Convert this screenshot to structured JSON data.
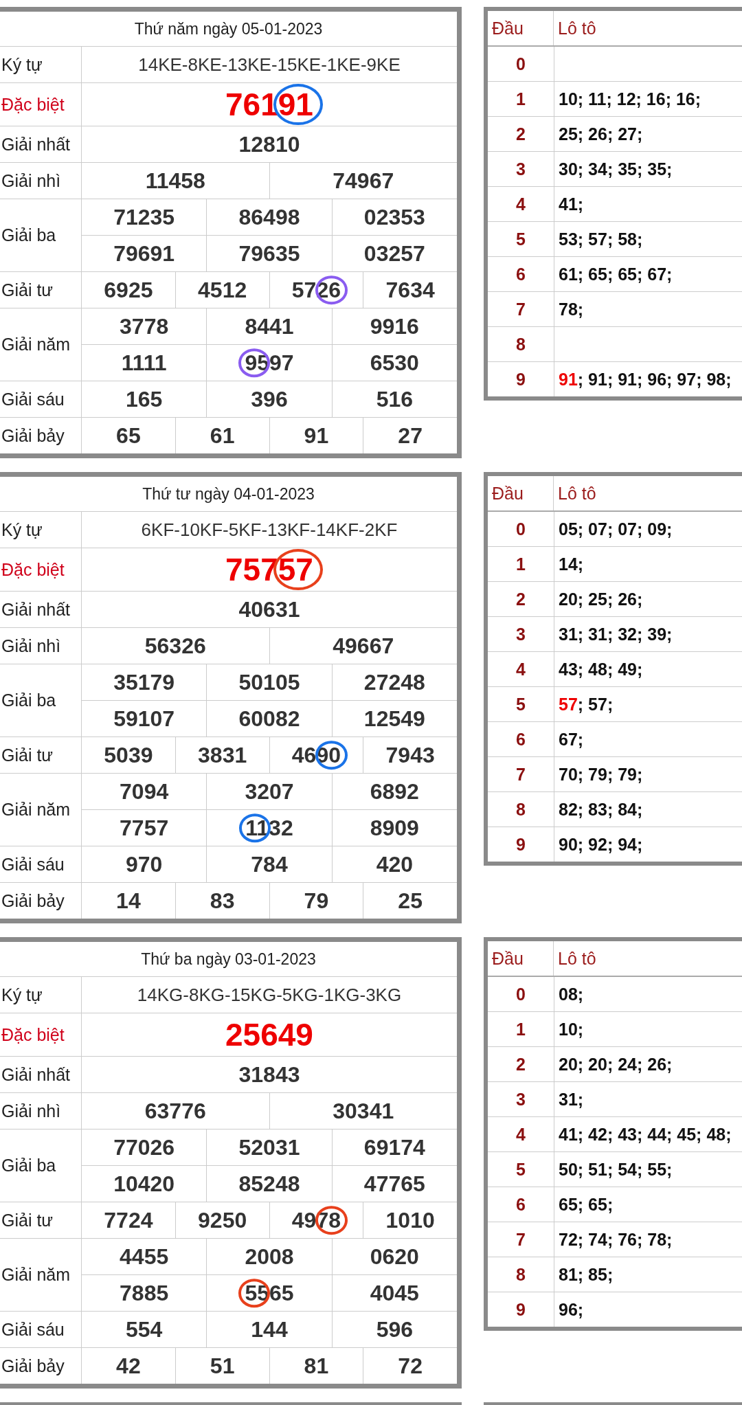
{
  "blocks": [
    {
      "kind": "full",
      "title": "Thứ năm ngày 05-01-2023",
      "prizes": [
        {
          "kind": "code",
          "label": "Ký tự",
          "rows": [
            [
              "14KE-8KE-13KE-15KE-1KE-9KE"
            ]
          ]
        },
        {
          "kind": "special",
          "label": "Đặc biệt",
          "rows": [
            [
              {
                "text": "76191",
                "circle": {
                  "color": "#1a73e8",
                  "at_end": true
                }
              }
            ]
          ]
        },
        {
          "kind": "normal",
          "label": "Giải nhất",
          "rows": [
            [
              "12810"
            ]
          ]
        },
        {
          "kind": "normal",
          "label": "Giải nhì",
          "rows": [
            [
              "11458",
              "74967"
            ]
          ]
        },
        {
          "kind": "normal",
          "label": "Giải ba",
          "rows": [
            [
              "71235",
              "86498",
              "02353"
            ],
            [
              "79691",
              "79635",
              "03257"
            ]
          ]
        },
        {
          "kind": "normal",
          "label": "Giải tư",
          "rows": [
            [
              "6925",
              "4512",
              {
                "text": "5726",
                "circle": {
                  "color": "#8a5cf0",
                  "at_end": true
                }
              },
              "7634"
            ]
          ]
        },
        {
          "kind": "normal",
          "label": "Giải năm",
          "rows": [
            [
              "3778",
              "8441",
              "9916"
            ],
            [
              "1111",
              {
                "text": "9597",
                "circle": {
                  "color": "#8a5cf0",
                  "at_end": false
                }
              },
              "6530"
            ]
          ]
        },
        {
          "kind": "normal",
          "label": "Giải sáu",
          "rows": [
            [
              "165",
              "396",
              "516"
            ]
          ]
        },
        {
          "kind": "normal",
          "label": "Giải bảy",
          "rows": [
            [
              "65",
              "61",
              "91",
              "27"
            ]
          ]
        }
      ],
      "loto": {
        "headers": [
          "Đầu",
          "Lô tô"
        ],
        "rows": [
          {
            "head": "0"
          },
          {
            "head": "1",
            "parts": [
              {
                "text": "10; 11; 12; 16; 16;",
                "special": false
              }
            ]
          },
          {
            "head": "2",
            "parts": [
              {
                "text": "25; 26; 27;",
                "special": false
              }
            ]
          },
          {
            "head": "3",
            "parts": [
              {
                "text": "30; 34; 35; 35;",
                "special": false
              }
            ]
          },
          {
            "head": "4",
            "parts": [
              {
                "text": "41;",
                "special": false
              }
            ]
          },
          {
            "head": "5",
            "parts": [
              {
                "text": "53; 57; 58;",
                "special": false
              }
            ]
          },
          {
            "head": "6",
            "parts": [
              {
                "text": "61; 65; 65; 67;",
                "special": false
              }
            ]
          },
          {
            "head": "7",
            "parts": [
              {
                "text": "78;",
                "special": false
              }
            ]
          },
          {
            "head": "8"
          },
          {
            "head": "9",
            "parts": [
              {
                "text": "91",
                "special": true
              },
              {
                "text": "; 91; 91; 96; 97; 98;",
                "special": false
              }
            ]
          }
        ]
      }
    },
    {
      "kind": "full",
      "title": "Thứ tư ngày 04-01-2023",
      "prizes": [
        {
          "kind": "code",
          "label": "Ký tự",
          "rows": [
            [
              "6KF-10KF-5KF-13KF-14KF-2KF"
            ]
          ]
        },
        {
          "kind": "special",
          "label": "Đặc biệt",
          "rows": [
            [
              {
                "text": "75757",
                "circle": {
                  "color": "#e8401c",
                  "at_end": true
                }
              }
            ]
          ]
        },
        {
          "kind": "normal",
          "label": "Giải nhất",
          "rows": [
            [
              "40631"
            ]
          ]
        },
        {
          "kind": "normal",
          "label": "Giải nhì",
          "rows": [
            [
              "56326",
              "49667"
            ]
          ]
        },
        {
          "kind": "normal",
          "label": "Giải ba",
          "rows": [
            [
              "35179",
              "50105",
              "27248"
            ],
            [
              "59107",
              "60082",
              "12549"
            ]
          ]
        },
        {
          "kind": "normal",
          "label": "Giải tư",
          "rows": [
            [
              "5039",
              "3831",
              {
                "text": "4690",
                "circle": {
                  "color": "#1a73e8",
                  "at_end": true
                }
              },
              "7943"
            ]
          ]
        },
        {
          "kind": "normal",
          "label": "Giải năm",
          "rows": [
            [
              "7094",
              "3207",
              "6892"
            ],
            [
              "7757",
              {
                "text": "1132",
                "circle": {
                  "color": "#1a73e8",
                  "at_end": false
                }
              },
              "8909"
            ]
          ]
        },
        {
          "kind": "normal",
          "label": "Giải sáu",
          "rows": [
            [
              "970",
              "784",
              "420"
            ]
          ]
        },
        {
          "kind": "normal",
          "label": "Giải bảy",
          "rows": [
            [
              "14",
              "83",
              "79",
              "25"
            ]
          ]
        }
      ],
      "loto": {
        "headers": [
          "Đầu",
          "Lô tô"
        ],
        "rows": [
          {
            "head": "0",
            "parts": [
              {
                "text": "05; 07; 07; 09;",
                "special": false
              }
            ]
          },
          {
            "head": "1",
            "parts": [
              {
                "text": "14;",
                "special": false
              }
            ]
          },
          {
            "head": "2",
            "parts": [
              {
                "text": "20; 25; 26;",
                "special": false
              }
            ]
          },
          {
            "head": "3",
            "parts": [
              {
                "text": "31; 31; 32; 39;",
                "special": false
              }
            ]
          },
          {
            "head": "4",
            "parts": [
              {
                "text": "43; 48; 49;",
                "special": false
              }
            ]
          },
          {
            "head": "5",
            "parts": [
              {
                "text": "57",
                "special": true
              },
              {
                "text": "; 57;",
                "special": false
              }
            ]
          },
          {
            "head": "6",
            "parts": [
              {
                "text": "67;",
                "special": false
              }
            ]
          },
          {
            "head": "7",
            "parts": [
              {
                "text": "70; 79; 79;",
                "special": false
              }
            ]
          },
          {
            "head": "8",
            "parts": [
              {
                "text": "82; 83; 84;",
                "special": false
              }
            ]
          },
          {
            "head": "9",
            "parts": [
              {
                "text": "90; 92; 94;",
                "special": false
              }
            ]
          }
        ]
      }
    },
    {
      "kind": "full",
      "title": "Thứ ba ngày 03-01-2023",
      "prizes": [
        {
          "kind": "code",
          "label": "Ký tự",
          "rows": [
            [
              "14KG-8KG-15KG-5KG-1KG-3KG"
            ]
          ]
        },
        {
          "kind": "special",
          "label": "Đặc biệt",
          "rows": [
            [
              "25649"
            ]
          ]
        },
        {
          "kind": "normal",
          "label": "Giải nhất",
          "rows": [
            [
              "31843"
            ]
          ]
        },
        {
          "kind": "normal",
          "label": "Giải nhì",
          "rows": [
            [
              "63776",
              "30341"
            ]
          ]
        },
        {
          "kind": "normal",
          "label": "Giải ba",
          "rows": [
            [
              "77026",
              "52031",
              "69174"
            ],
            [
              "10420",
              "85248",
              "47765"
            ]
          ]
        },
        {
          "kind": "normal",
          "label": "Giải tư",
          "rows": [
            [
              "7724",
              "9250",
              {
                "text": "4978",
                "circle": {
                  "color": "#e8401c",
                  "at_end": true
                }
              },
              "1010"
            ]
          ]
        },
        {
          "kind": "normal",
          "label": "Giải năm",
          "rows": [
            [
              "4455",
              "2008",
              "0620"
            ],
            [
              "7885",
              {
                "text": "5565",
                "circle": {
                  "color": "#e8401c",
                  "at_end": false
                }
              },
              "4045"
            ]
          ]
        },
        {
          "kind": "normal",
          "label": "Giải sáu",
          "rows": [
            [
              "554",
              "144",
              "596"
            ]
          ]
        },
        {
          "kind": "normal",
          "label": "Giải bảy",
          "rows": [
            [
              "42",
              "51",
              "81",
              "72"
            ]
          ]
        }
      ],
      "loto": {
        "headers": [
          "Đầu",
          "Lô tô"
        ],
        "rows": [
          {
            "head": "0",
            "parts": [
              {
                "text": "08;",
                "special": false
              }
            ]
          },
          {
            "head": "1",
            "parts": [
              {
                "text": "10;",
                "special": false
              }
            ]
          },
          {
            "head": "2",
            "parts": [
              {
                "text": "20; 20; 24; 26;",
                "special": false
              }
            ]
          },
          {
            "head": "3",
            "parts": [
              {
                "text": "31;",
                "special": false
              }
            ]
          },
          {
            "head": "4",
            "parts": [
              {
                "text": "41; 42; 43; 44; 45; 48;",
                "special": false
              }
            ]
          },
          {
            "head": "5",
            "parts": [
              {
                "text": "50; 51; 54; 55;",
                "special": false
              }
            ]
          },
          {
            "head": "6",
            "parts": [
              {
                "text": "65; 65;",
                "special": false
              }
            ]
          },
          {
            "head": "7",
            "parts": [
              {
                "text": "72; 74; 76; 78;",
                "special": false
              }
            ]
          },
          {
            "head": "8",
            "parts": [
              {
                "text": "81; 85;",
                "special": false
              }
            ]
          },
          {
            "head": "9",
            "parts": [
              {
                "text": "96;",
                "special": false
              }
            ]
          }
        ]
      }
    },
    {
      "kind": "cut"
    }
  ]
}
